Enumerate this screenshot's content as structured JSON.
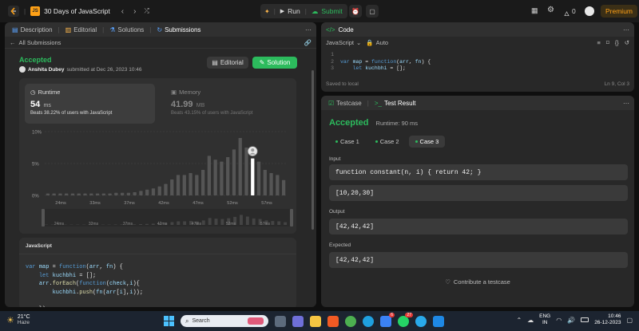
{
  "topbar": {
    "list_name": "30 Days of JavaScript",
    "run_label": "Run",
    "submit_label": "Submit",
    "streak_count": "0",
    "premium_label": "Premium"
  },
  "left_tabs": {
    "description": "Description",
    "editorial": "Editorial",
    "solutions": "Solutions",
    "submissions": "Submissions"
  },
  "submission": {
    "back_label": "All Submissions",
    "status": "Accepted",
    "user": "Anshita Dubey",
    "submitted_text": "submitted at Dec 26, 2023 10:46",
    "editorial_btn": "Editorial",
    "solution_btn": "Solution",
    "runtime_title": "Runtime",
    "runtime_value": "54",
    "runtime_unit": "ms",
    "runtime_beats": "Beats 38.22% of users with JavaScript",
    "memory_title": "Memory",
    "memory_value": "41.99",
    "memory_unit": "MB",
    "memory_beats": "Beats 43.15% of users with JavaScript",
    "code_lang": "JavaScript",
    "code_lines": [
      "var map = function(arr, fn) {",
      "    let kuchbhi = [];",
      "    arr.forEach(function(check,i){",
      "        kuchbhi.push(fn(arr[i],i));",
      "",
      "    });"
    ]
  },
  "chart_data": {
    "type": "bar",
    "ylabels": [
      "10%",
      "5%",
      "0%"
    ],
    "xlabels": [
      "24ms",
      "33ms",
      "37ms",
      "42ms",
      "47ms",
      "52ms",
      "57ms"
    ],
    "minimap_labels": [
      "24ms",
      "32ms",
      "37ms",
      "42ms",
      "47ms",
      "52ms",
      "57ms"
    ],
    "values": [
      0.3,
      0.3,
      0.3,
      0.3,
      0.3,
      0.3,
      0.3,
      0.3,
      0.3,
      0.3,
      0.3,
      0.4,
      0.4,
      0.4,
      0.5,
      0.7,
      0.9,
      1.1,
      1.4,
      1.8,
      2.5,
      3.2,
      3.2,
      3.5,
      3.2,
      4.0,
      6.2,
      5.6,
      5.3,
      6.0,
      7.2,
      9.0,
      7.5,
      5.8,
      5.3,
      4.0,
      3.5,
      3.2,
      2.4
    ],
    "highlight_index": 33,
    "ylim": [
      0,
      10
    ]
  },
  "code_editor": {
    "title": "Code",
    "lang": "JavaScript",
    "auto_label": "Auto",
    "line_numbers": [
      "1",
      "2",
      "3"
    ],
    "lines": [
      "",
      "var map = function(arr, fn) {",
      "    let kuchbhi = [];"
    ],
    "saved": "Saved to local",
    "cursor": "Ln 9, Col 3"
  },
  "result": {
    "testcase_tab": "Testcase",
    "result_tab": "Test Result",
    "status": "Accepted",
    "runtime": "Runtime: 90 ms",
    "cases": [
      "Case 1",
      "Case 2",
      "Case 3"
    ],
    "input_label": "Input",
    "input_fn": "function constant(n, i) { return 42; }",
    "input_arr": "[10,20,30]",
    "output_label": "Output",
    "output_val": "[42,42,42]",
    "expected_label": "Expected",
    "expected_val": "[42,42,42]",
    "contribute": "Contribute a testcase"
  },
  "taskbar": {
    "weather_temp": "21°C",
    "weather_desc": "Haze",
    "search_placeholder": "Search",
    "lang1": "ENG",
    "lang2": "IN",
    "time": "10:46",
    "date": "26-12-2023",
    "badge1": "6",
    "badge2": "27"
  }
}
